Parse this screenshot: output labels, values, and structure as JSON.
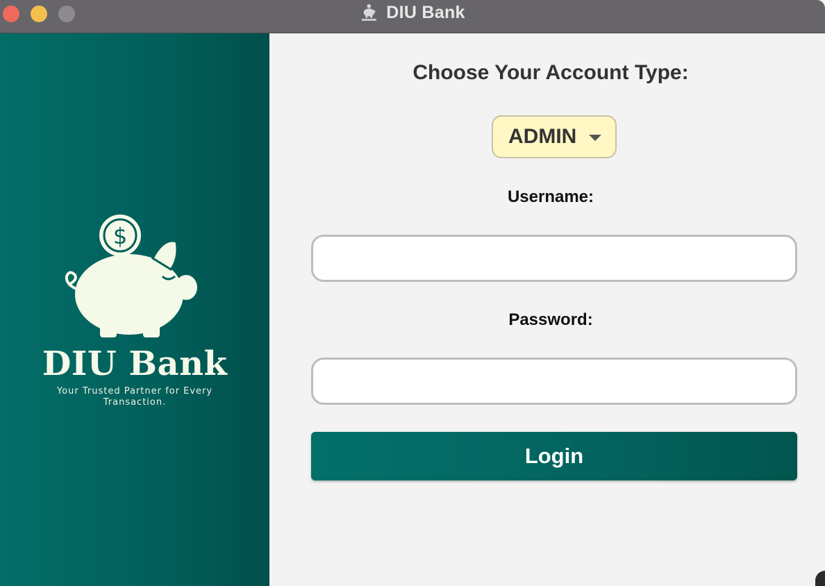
{
  "window": {
    "title": "DIU Bank",
    "title_icon": "piggy-bank-icon"
  },
  "sidebar": {
    "brand_name": "DIU Bank",
    "tagline": "Your Trusted Partner for Every Transaction.",
    "logo_icon": "piggy-bank-icon"
  },
  "form": {
    "title": "Choose Your Account Type:",
    "account_type": {
      "selected": "ADMIN"
    },
    "username_label": "Username:",
    "username_value": "",
    "password_label": "Password:",
    "password_value": "",
    "login_label": "Login"
  },
  "colors": {
    "titlebar": "#676569",
    "sidebar": "#036d68",
    "select_background": "#fff7c4",
    "button": "#04706b",
    "background": "#f3f3f3",
    "traffic_close": "#ee6a5e",
    "traffic_minimize": "#f5bf4f",
    "traffic_maximize": "#8d8b90"
  }
}
